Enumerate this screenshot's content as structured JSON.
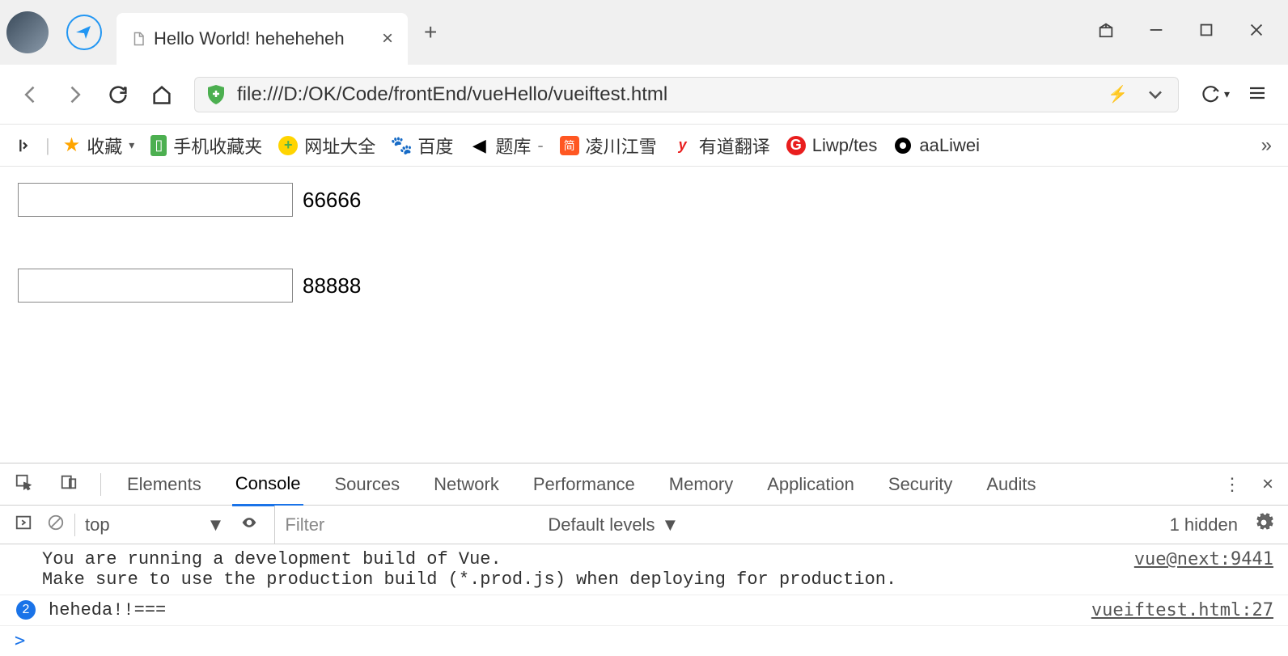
{
  "tab": {
    "title": "Hello World! heheheheh"
  },
  "address": {
    "url": "file:///D:/OK/Code/frontEnd/vueHello/vueiftest.html"
  },
  "bookmarks": {
    "favorites": "收藏",
    "mobile": "手机收藏夹",
    "items": [
      {
        "label": "网址大全"
      },
      {
        "label": "百度"
      },
      {
        "label": "题库"
      },
      {
        "label": "凌川江雪"
      },
      {
        "label": "有道翻译"
      },
      {
        "label": "Liwp/tes"
      },
      {
        "label": "aaLiwei"
      }
    ]
  },
  "page": {
    "row1_value": "",
    "row1_text": "66666",
    "row2_value": "",
    "row2_text": "88888"
  },
  "devtools": {
    "tabs": [
      "Elements",
      "Console",
      "Sources",
      "Network",
      "Performance",
      "Memory",
      "Application",
      "Security",
      "Audits"
    ],
    "active_tab": "Console",
    "context": "top",
    "filter_placeholder": "Filter",
    "levels": "Default levels",
    "hidden": "1 hidden",
    "messages": [
      {
        "text": "You are running a development build of Vue.\nMake sure to use the production build (*.prod.js) when deploying for production.",
        "source": "vue@next:9441"
      },
      {
        "count": "2",
        "text": "heheda!!===",
        "source": "vueiftest.html:27"
      }
    ],
    "prompt": ">"
  }
}
